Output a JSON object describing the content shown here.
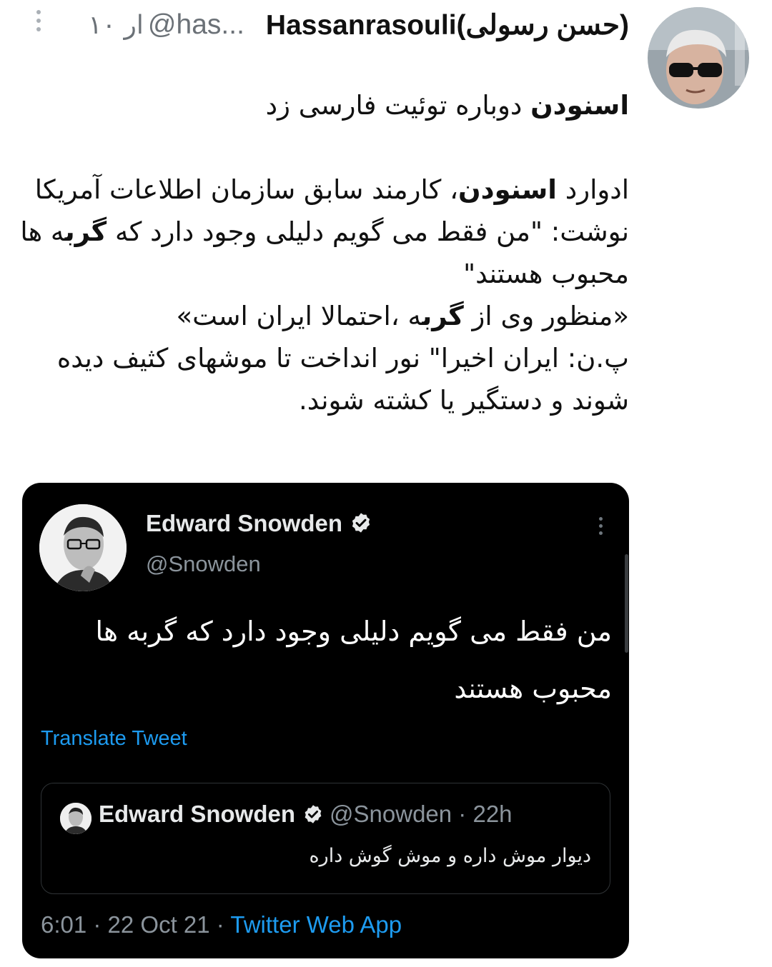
{
  "tweet": {
    "author": {
      "display_name": "Hassanrasouli(حسن رسولی)",
      "handle": "@has...",
      "time_ago": "۱۰ ار"
    },
    "body": {
      "line1_bold": "اسنودن",
      "line1_rest": " دوباره توئیت فارسی زد",
      "para2_a": "ادوارد ",
      "para2_bold1": "اسنودن",
      "para2_b": "، کارمند سابق سازمان اطلاعات آمریکا نوشت: \"من فقط می گویم دلیلی وجود دارد که ",
      "para2_bold2": "گرب",
      "para2_c": "ه ها محبوب هستند\"",
      "para3_a": "«منظور وی از ",
      "para3_bold": "گرب",
      "para3_b": "ه ،احتمالا ایران است»",
      "para4": "پ.ن: ایران اخیرا\" نور انداخت تا موشهای کثیف دیده شوند و دستگیر یا کشته شوند."
    }
  },
  "embed": {
    "name": "Edward Snowden",
    "handle": "@Snowden",
    "text": "من فقط می گویم دلیلی وجود دارد که گربه ها محبوب هستند",
    "translate_label": "Translate Tweet",
    "quote": {
      "name": "Edward Snowden",
      "meta": "@Snowden · 22h",
      "text": "دیوار موش داره و موش گوش داره"
    },
    "footer": {
      "time": "6:01 · 22 Oct 21 ·",
      "source": "Twitter Web App"
    }
  },
  "colors": {
    "link_blue": "#1d9bf0",
    "muted_gray": "#6b7177",
    "embed_bg": "#000000"
  },
  "icons": [
    "more-vertical-icon",
    "verified-badge-icon"
  ]
}
